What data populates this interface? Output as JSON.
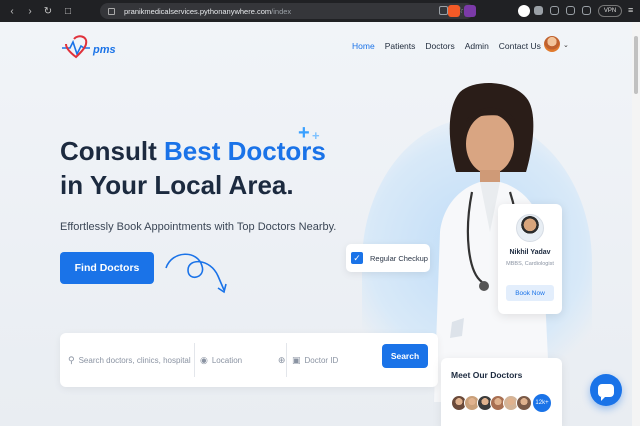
{
  "browser": {
    "url_host": "pranikmedicalservices.pythonanywhere.com",
    "url_path": "/index",
    "vpn_label": "VPN",
    "icons": [
      "back-icon",
      "forward-icon",
      "reload-icon",
      "lock-icon",
      "share-icon",
      "bookmark-icon",
      "extension-icon",
      "puzzle-icon",
      "menu-icon"
    ]
  },
  "brand": {
    "name": "pms",
    "accent": "#1a73e8",
    "logo_red": "#e0313b"
  },
  "nav": {
    "items": [
      {
        "label": "Home",
        "active": true
      },
      {
        "label": "Patients"
      },
      {
        "label": "Doctors"
      },
      {
        "label": "Admin"
      },
      {
        "label": "Contact Us"
      }
    ]
  },
  "hero": {
    "title_line1_prefix": "Consult ",
    "title_line1_accent": "Best Doctors",
    "title_line2": "in Your Local Area.",
    "subtitle": "Effortlessly Book Appointments with Top Doctors Nearby.",
    "cta_label": "Find Doctors"
  },
  "search": {
    "query_placeholder": "Search doctors, clinics, hospitals,",
    "location_placeholder": "Location",
    "doctor_id_placeholder": "Doctor ID",
    "button_label": "Search"
  },
  "badges": {
    "checkup_label": "Regular Checkup"
  },
  "doctor_card": {
    "name": "Nikhil Yadav",
    "specialty": "MBBS, Cardiologist",
    "button_label": "Book Now"
  },
  "meet": {
    "title": "Meet Our Doctors",
    "count_label": "12k+",
    "face_colors": [
      "#6b4a3a",
      "#c9a07a",
      "#3c3c3c",
      "#a86f52",
      "#d3b498",
      "#7a5a48"
    ]
  }
}
